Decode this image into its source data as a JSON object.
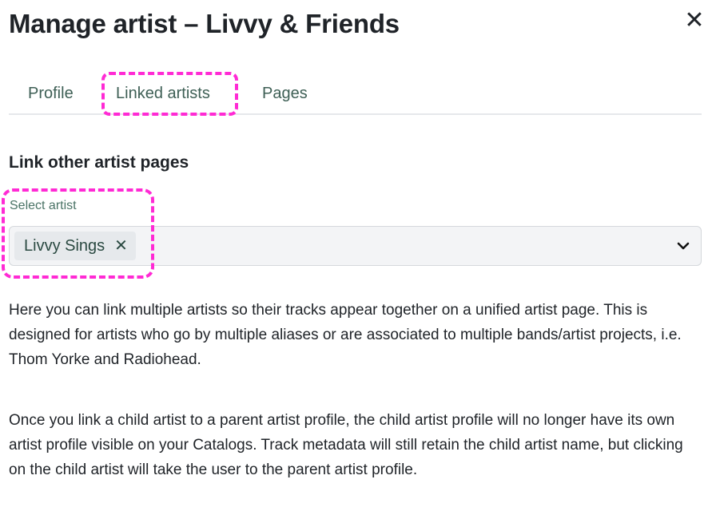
{
  "dialog": {
    "title": "Manage artist – Livvy & Friends",
    "close_glyph": "✕"
  },
  "tabs": [
    {
      "label": "Profile"
    },
    {
      "label": "Linked artists"
    },
    {
      "label": "Pages"
    }
  ],
  "section": {
    "title": "Link other artist pages"
  },
  "select": {
    "label": "Select artist",
    "selected_chip": "Livvy Sings",
    "chip_remove_glyph": "✕"
  },
  "description": {
    "paragraph1": "Here you can link multiple artists so their tracks appear together on a unified artist page. This is designed for artists who go by multiple aliases or are associated to multiple bands/artist projects, i.e. Thom Yorke and Radiohead.",
    "paragraph2": "Once you link a child artist to a parent artist profile, the child artist profile will no longer have its own artist profile visible on your Catalogs. Track metadata will still retain the child artist name, but clicking on the child artist will take the user to the parent artist profile."
  },
  "colors": {
    "highlight": "#ff2ad4",
    "tab_text": "#3e5f55",
    "label_text": "#4a7366"
  }
}
